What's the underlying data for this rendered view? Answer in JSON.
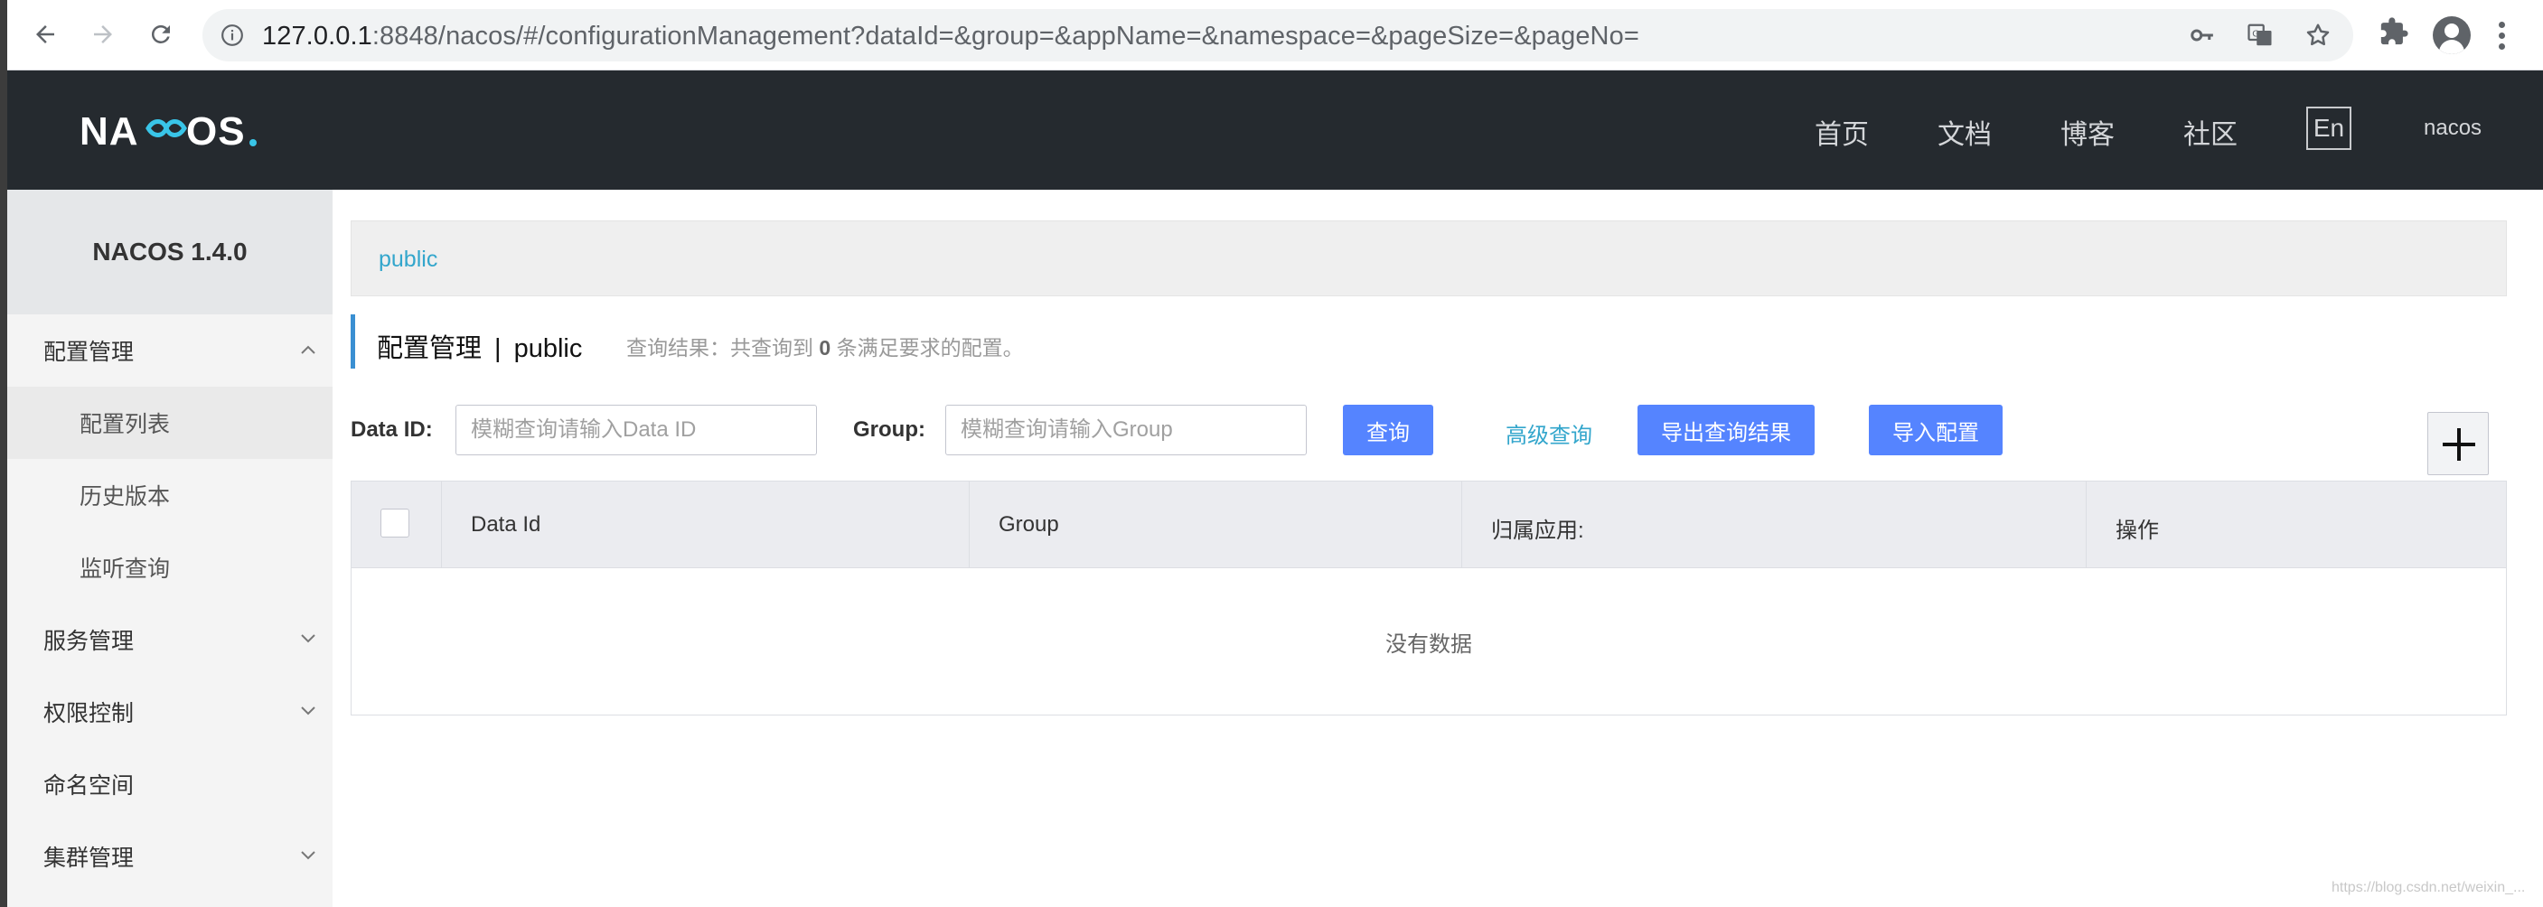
{
  "browser": {
    "url_host": "127.0.0.1",
    "url_rest": ":8848/nacos/#/configurationManagement?dataId=&group=&appName=&namespace=&pageSize=&pageNo="
  },
  "header": {
    "logo_text": "NACOS.",
    "nav": [
      "首页",
      "文档",
      "博客",
      "社区"
    ],
    "lang_label": "En",
    "user": "nacos"
  },
  "sidebar": {
    "title": "NACOS 1.4.0",
    "items": [
      {
        "label": "配置管理"
      },
      {
        "label": "配置列表"
      },
      {
        "label": "历史版本"
      },
      {
        "label": "监听查询"
      },
      {
        "label": "服务管理"
      },
      {
        "label": "权限控制"
      },
      {
        "label": "命名空间"
      },
      {
        "label": "集群管理"
      }
    ]
  },
  "namespace_bar": {
    "link": "public"
  },
  "page_title": {
    "main": "配置管理",
    "sep": "|",
    "ns": "public",
    "desc_prefix": "查询结果：共查询到",
    "count": "0",
    "desc_suffix": "条满足要求的配置。"
  },
  "search": {
    "dataid_label": "Data ID:",
    "dataid_placeholder": "模糊查询请输入Data ID",
    "group_label": "Group:",
    "group_placeholder": "模糊查询请输入Group",
    "query_btn": "查询",
    "advanced": "高级查询",
    "export_btn": "导出查询结果",
    "import_btn": "导入配置"
  },
  "table": {
    "columns": [
      "Data Id",
      "Group",
      "归属应用:",
      "操作"
    ],
    "empty": "没有数据"
  },
  "watermark": "https://blog.csdn.net/weixin_..."
}
